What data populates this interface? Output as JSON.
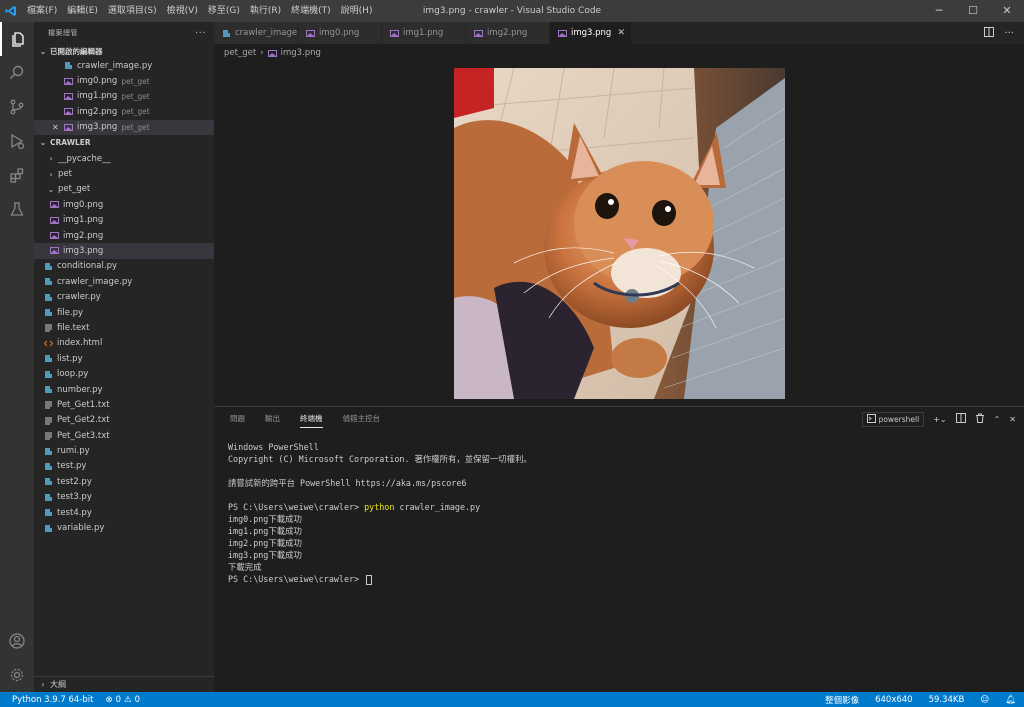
{
  "window": {
    "title": "img3.png - crawler - Visual Studio Code",
    "menu": [
      "檔案(F)",
      "編輯(E)",
      "選取項目(S)",
      "檢視(V)",
      "移至(G)",
      "執行(R)",
      "終端機(T)",
      "說明(H)"
    ],
    "controls": [
      "─",
      "☐",
      "✕"
    ]
  },
  "sidebar": {
    "header": "檔案總管",
    "more": "···",
    "open_editors_title": "已開啟的編輯器",
    "open_editors": [
      {
        "name": "crawler_image.py",
        "desc": ""
      },
      {
        "name": "img0.png",
        "desc": "pet_get"
      },
      {
        "name": "img1.png",
        "desc": "pet_get"
      },
      {
        "name": "img2.png",
        "desc": "pet_get"
      },
      {
        "name": "img3.png",
        "desc": "pet_get"
      }
    ],
    "folder_title": "CRAWLER",
    "tree": [
      {
        "name": "__pycache__",
        "chev": "›"
      },
      {
        "name": "pet",
        "chev": "›"
      },
      {
        "name": "pet_get",
        "chev": "⌄"
      },
      {
        "name": "img0.png"
      },
      {
        "name": "img1.png"
      },
      {
        "name": "img2.png"
      },
      {
        "name": "img3.png"
      },
      {
        "name": "conditional.py"
      },
      {
        "name": "crawler_image.py"
      },
      {
        "name": "crawler.py"
      },
      {
        "name": "file.py"
      },
      {
        "name": "file.text"
      },
      {
        "name": "index.html"
      },
      {
        "name": "list.py"
      },
      {
        "name": "loop.py"
      },
      {
        "name": "number.py"
      },
      {
        "name": "Pet_Get1.txt"
      },
      {
        "name": "Pet_Get2.txt"
      },
      {
        "name": "Pet_Get3.txt"
      },
      {
        "name": "rumi.py"
      },
      {
        "name": "test.py"
      },
      {
        "name": "test2.py"
      },
      {
        "name": "test3.py"
      },
      {
        "name": "test4.py"
      },
      {
        "name": "variable.py"
      }
    ],
    "outline": "大綱",
    "close_mark": "✕"
  },
  "tabs": [
    {
      "label": "crawler_image.py"
    },
    {
      "label": "img0.png"
    },
    {
      "label": "img1.png"
    },
    {
      "label": "img2.png"
    },
    {
      "label": "img3.png"
    }
  ],
  "tab_close": "✕",
  "breadcrumb": {
    "folder": "pet_get",
    "sep": "›",
    "file": "img3.png"
  },
  "panel": {
    "tabs": [
      "問題",
      "輸出",
      "終端機",
      "偵錯主控台"
    ],
    "shell": "powershell",
    "terminal": {
      "line1": "Windows PowerShell",
      "line2": "Copyright (C) Microsoft Corporation. 著作權所有，並保留一切權利。",
      "line3": "請嘗試新的跨平台 PowerShell https://aka.ms/pscore6",
      "prompt": "PS C:\\Users\\weiwe\\crawler> ",
      "cmd_py": "python",
      "cmd_args": " crawler_image.py",
      "out1": "img0.png下載成功",
      "out2": "img1.png下載成功",
      "out3": "img2.png下載成功",
      "out4": "img3.png下載成功",
      "out5": "下載完成",
      "prompt2": "PS C:\\Users\\weiwe\\crawler> "
    }
  },
  "status": {
    "python": "Python 3.9.7 64-bit",
    "errors": "0",
    "warnings": "0",
    "image_label": "整個影像",
    "dims": "640x640",
    "size": "59.34KB"
  },
  "colors": {
    "accent": "#007acc",
    "py_icon": "#519aba",
    "png_icon": "#a074c4",
    "html_icon": "#e37933"
  }
}
